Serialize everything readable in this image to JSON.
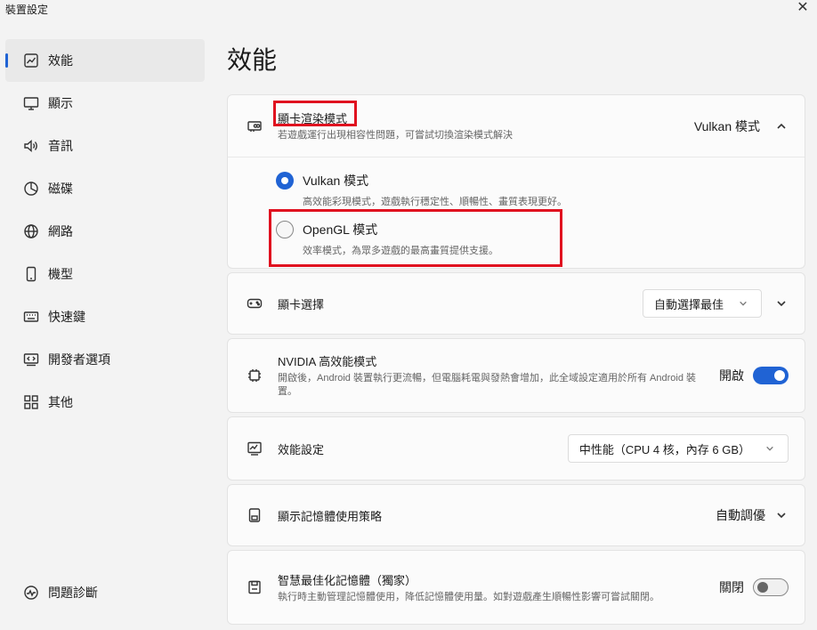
{
  "window": {
    "title": "裝置設定",
    "close": "✕"
  },
  "sidebar": {
    "items": [
      {
        "label": "效能",
        "icon": "performance-chart-icon"
      },
      {
        "label": "顯示",
        "icon": "monitor-icon"
      },
      {
        "label": "音訊",
        "icon": "speaker-icon"
      },
      {
        "label": "磁碟",
        "icon": "disk-pie-icon"
      },
      {
        "label": "網路",
        "icon": "globe-icon"
      },
      {
        "label": "機型",
        "icon": "phone-icon"
      },
      {
        "label": "快速鍵",
        "icon": "keyboard-icon"
      },
      {
        "label": "開發者選項",
        "icon": "developer-icon"
      },
      {
        "label": "其他",
        "icon": "grid-icon"
      }
    ],
    "bottom": {
      "label": "問題診斷",
      "icon": "diagnostics-icon"
    }
  },
  "page": {
    "title": "效能"
  },
  "render_mode": {
    "title": "顯卡渲染模式",
    "subtitle": "若遊戲運行出現相容性問題，可嘗試切換渲染模式解決",
    "value": "Vulkan 模式",
    "options": [
      {
        "label": "Vulkan 模式",
        "desc": "高效能彩現模式，遊戲執行穩定性、順暢性、畫質表現更好。",
        "checked": true
      },
      {
        "label": "OpenGL 模式",
        "desc": "效率模式，為眾多遊戲的最高畫質提供支援。",
        "checked": false
      }
    ]
  },
  "gpu_select": {
    "title": "顯卡選擇",
    "value": "自動選擇最佳"
  },
  "nvidia": {
    "title": "NVIDIA 高效能模式",
    "subtitle": "開啟後，Android 裝置執行更流暢，但電腦耗電與發熱會增加，此全域設定適用於所有 Android 裝置。",
    "state_label": "開啟",
    "on": true
  },
  "perf_setting": {
    "title": "效能設定",
    "value": "中性能（CPU 4 核，內存 6 GB）"
  },
  "display_memory": {
    "title": "顯示記憶體使用策略",
    "value": "自動調優"
  },
  "smart_memory": {
    "title": "智慧最佳化記憶體（獨家）",
    "subtitle": "執行時主動管理記憶體使用，降低記憶體使用量。如對遊戲產生順暢性影響可嘗試關閉。",
    "state_label": "關閉",
    "on": false
  },
  "colors": {
    "accent": "#2063d4",
    "highlight": "#e0101f"
  }
}
